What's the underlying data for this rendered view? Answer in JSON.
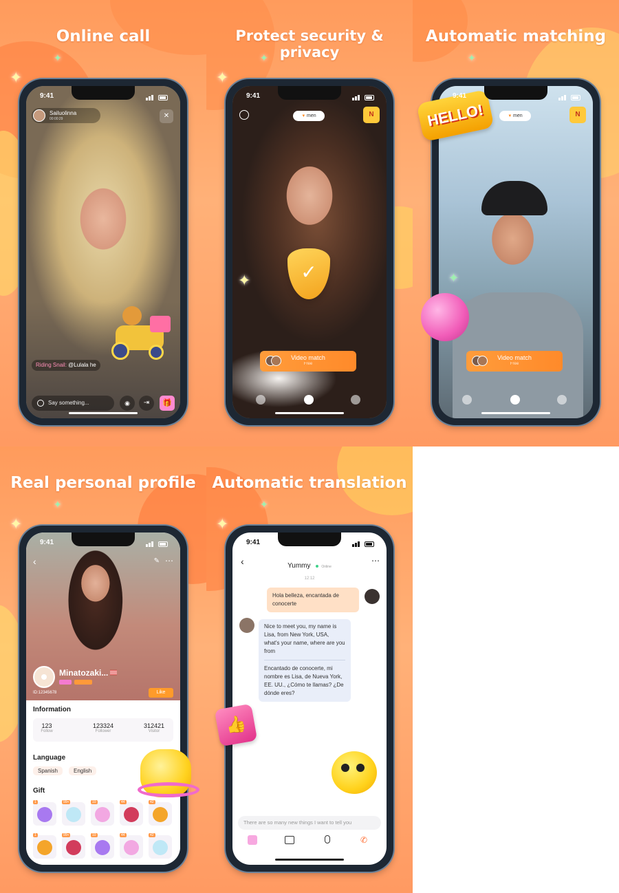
{
  "colors": {
    "accent": "#ff8a2a",
    "bg_orange": "#ff9b5c",
    "chat_out": "#ffe0c6",
    "chat_in": "#e9eef9"
  },
  "panels": [
    {
      "title": "Online call"
    },
    {
      "title": "Protect security & privacy"
    },
    {
      "title": "Automatic matching"
    },
    {
      "title": "Real personal profile"
    },
    {
      "title": "Automatic translation"
    }
  ],
  "status_time": "9:41",
  "call": {
    "caller_name": "Sailuolinna",
    "duration": "00:00:29",
    "gift_msg_prefix": "Riding Snail:",
    "gift_msg_user": "@Lulala he",
    "input_placeholder": "Say something...",
    "close_icon": "close-icon"
  },
  "match": {
    "filter_chip": "men",
    "button_label": "Video match",
    "button_sub": "Free"
  },
  "profile": {
    "name": "Minatozaki...",
    "id": "ID:12345678",
    "like_label": "Like",
    "section_info": "Information",
    "stats": [
      {
        "value": "123",
        "label": "Follow"
      },
      {
        "value": "123324",
        "label": "Follower"
      },
      {
        "value": "312421",
        "label": "Visitor"
      }
    ],
    "section_language": "Language",
    "languages": [
      "Spanish",
      "English"
    ],
    "section_gift": "Gift"
  },
  "chat": {
    "contact_name": "Yummy",
    "contact_status": "Online",
    "timestamp": "12:12",
    "msg_out": "Hola belleza, encantada de conocerte",
    "msg_in_original": "Nice to meet you, my name is Lisa, from New York, USA, what's your name, where are you from",
    "msg_in_translated": "Encantado de conocerte, mi nombre es Lisa, de Nueva York, EE. UU., ¿Cómo te llamas? ¿De dónde eres?",
    "input_placeholder": "There are so many new things I want to tell you"
  },
  "sticker_text": "HELLO!"
}
